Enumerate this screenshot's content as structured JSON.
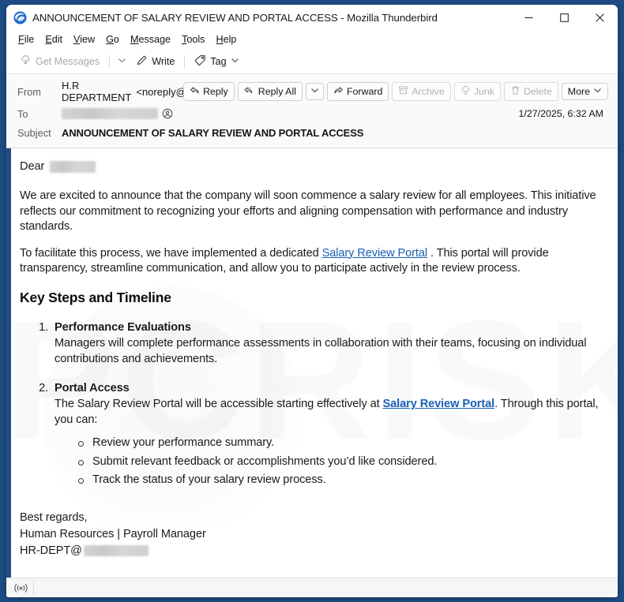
{
  "window": {
    "title": "ANNOUNCEMENT OF SALARY REVIEW AND PORTAL ACCESS - Mozilla Thunderbird",
    "app_icon": "thunderbird-logo-icon",
    "controls": {
      "minimize": "minimize-icon",
      "maximize": "maximize-icon",
      "close": "close-icon"
    },
    "accent_blue": "#1f4e87"
  },
  "menubar": {
    "items": [
      {
        "label": "File",
        "accel": "F"
      },
      {
        "label": "Edit",
        "accel": "E"
      },
      {
        "label": "View",
        "accel": "V"
      },
      {
        "label": "Go",
        "accel": "G"
      },
      {
        "label": "Message",
        "accel": "M"
      },
      {
        "label": "Tools",
        "accel": "T"
      },
      {
        "label": "Help",
        "accel": "H"
      }
    ]
  },
  "toolbar": {
    "get_messages": "Get Messages",
    "get_messages_enabled": false,
    "write": "Write",
    "tag": "Tag"
  },
  "message_header": {
    "from_label": "From",
    "from_name": "H.R DEPARTMENT",
    "from_address_prefix": "<noreply@",
    "from_address_suffix": ">",
    "from_redacted": true,
    "to_label": "To",
    "to_redacted": true,
    "subject_label": "Subject",
    "subject": "ANNOUNCEMENT OF SALARY REVIEW AND PORTAL ACCESS",
    "date": "1/27/2025, 6:32 AM",
    "actions": [
      {
        "label": "Reply",
        "icon": "reply-icon",
        "enabled": true
      },
      {
        "label": "Reply All",
        "icon": "reply-all-icon",
        "enabled": true
      },
      {
        "label": "",
        "icon": "chevron-down-icon",
        "enabled": true
      },
      {
        "label": "Forward",
        "icon": "forward-icon",
        "enabled": true
      },
      {
        "label": "Archive",
        "icon": "archive-icon",
        "enabled": false
      },
      {
        "label": "Junk",
        "icon": "junk-icon",
        "enabled": false
      },
      {
        "label": "Delete",
        "icon": "trash-icon",
        "enabled": false
      },
      {
        "label": "More",
        "icon": "chevron-down-icon",
        "enabled": true
      }
    ]
  },
  "body": {
    "watermark_text": "PCRISK",
    "greeting": "Dear",
    "greeting_redacted": true,
    "paragraph_1": "We are excited to announce that the company will soon commence a salary review for all employees. This initiative reflects our commitment to recognizing your efforts and aligning compensation with performance and industry standards.",
    "paragraph_2_before": "To facilitate this process, we have implemented a dedicated ",
    "paragraph_2_link": "Salary Review Portal",
    "paragraph_2_after": " . This portal will provide transparency, streamline communication, and allow you to participate actively in the review process.",
    "heading": "Key Steps and Timeline",
    "steps": [
      {
        "title": "Performance Evaluations",
        "text": "Managers will complete performance assessments in collaboration with their teams, focusing on individual contributions and achievements."
      },
      {
        "title": "Portal Access",
        "text_before": "The Salary Review Portal will be accessible starting effectively at ",
        "link": "Salary Review Portal",
        "text_after": ". Through this portal, you can:",
        "sub_items": [
          "Review your performance summary.",
          "Submit relevant feedback or accomplishments you’d like considered.",
          "Track the status of your salary review process."
        ]
      }
    ],
    "signoff": "Best regards,",
    "signature_line": "Human Resources | Payroll Manager",
    "signature_email_prefix": "HR-DEPT@",
    "signature_email_redacted": true,
    "link_color": "#1a5fb4"
  },
  "statusbar": {
    "indicator_icon": "online-status-icon"
  }
}
